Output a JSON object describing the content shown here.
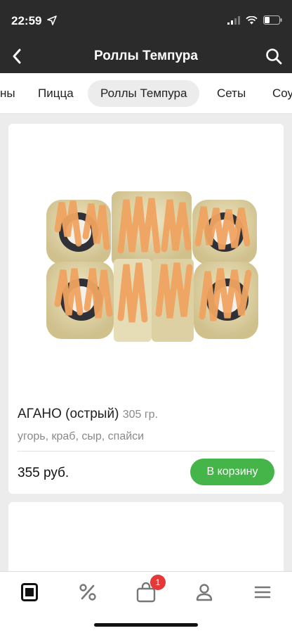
{
  "status_bar": {
    "time": "22:59"
  },
  "nav": {
    "title": "Роллы Темпура"
  },
  "tabs": [
    {
      "label": "ны"
    },
    {
      "label": "Пицца"
    },
    {
      "label": "Роллы Темпура",
      "active": true
    },
    {
      "label": "Сеты"
    },
    {
      "label": "Соу"
    }
  ],
  "product": {
    "name": "АГАНО (острый)",
    "weight": "305 гр.",
    "description": "угорь, краб, сыр, спайси",
    "price": "355 руб.",
    "cart_button": "В корзину"
  },
  "bottom_bar": {
    "cart_badge": "1"
  },
  "colors": {
    "header_bg": "#2b2b2b",
    "accent_green": "#45b549",
    "badge_red": "#e53939"
  }
}
